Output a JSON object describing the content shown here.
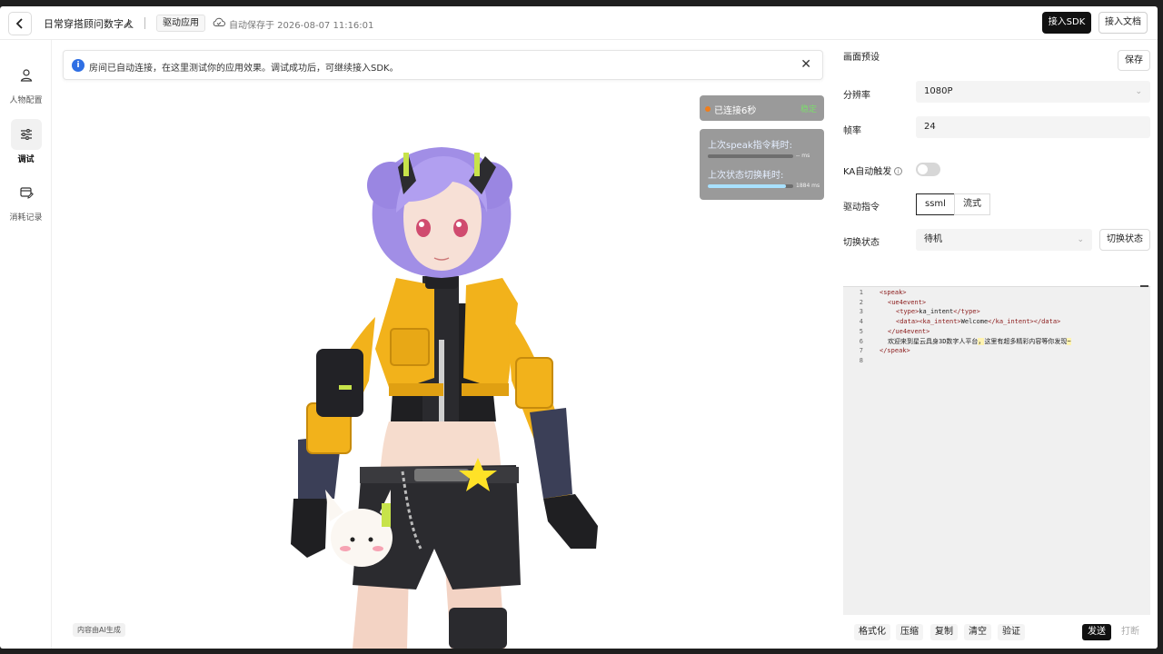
{
  "header": {
    "title": "日常穿搭顾问数字人",
    "tag": "驱动应用",
    "autosave": "自动保存于 2026-08-07 11:16:01",
    "sdk_button": "接入SDK",
    "doc_button": "接入文档"
  },
  "sidebar": {
    "items": [
      {
        "label": "人物配置",
        "icon": "person-icon"
      },
      {
        "label": "调试",
        "icon": "sliders-icon"
      },
      {
        "label": "消耗记录",
        "icon": "card-edit-icon"
      }
    ],
    "active": "调试"
  },
  "stage": {
    "notice": "房间已自动连接，在这里测试你的应用效果。调试成功后，可继续接入SDK。",
    "connection_text": "已连接6秒",
    "connection_status": "稳定",
    "metrics": [
      {
        "label": "上次speak指令耗时:",
        "value": "-- ms",
        "fill": 0
      },
      {
        "label": "上次状态切换耗时:",
        "value": "1884 ms",
        "fill": 0.92
      }
    ],
    "ai_tag": "内容由AI生成"
  },
  "panel": {
    "section_title": "画面预设",
    "save_button": "保存",
    "resolution_label": "分辨率",
    "resolution_value": "1080P",
    "framerate_label": "帧率",
    "framerate_value": "24",
    "ka_label": "KA自动触发",
    "ka_enabled": false,
    "drive_label": "驱动指令",
    "drive_options": [
      "ssml",
      "流式"
    ],
    "drive_selected": "ssml",
    "switch_label": "切换状态",
    "switch_value": "待机",
    "switch_button": "切换状态"
  },
  "editor": {
    "line_numbers": [
      "1",
      "2",
      "3",
      "4",
      "5",
      "6",
      "7",
      "8"
    ],
    "lines": {
      "l1": "<speak>",
      "l2": "<ue4event>",
      "l3a": "<type>",
      "l3b": "ka_intent",
      "l3c": "</type>",
      "l4a": "<data><ka_intent>",
      "l4b": "Welcome",
      "l4c": "</ka_intent></data>",
      "l5": "</ue4event>",
      "l6a": "欢迎来到星云具身3D数字人平台",
      "l6b": "，",
      "l6c": "这里有超多精彩内容等你发现",
      "l6d": "~",
      "l7": "</speak>"
    }
  },
  "toolbar": {
    "format": "格式化",
    "compress": "压缩",
    "copy": "复制",
    "clear": "清空",
    "validate": "验证",
    "send": "发送",
    "interrupt": "打断"
  },
  "colors": {
    "accent": "#111111",
    "info": "#2f6fe4",
    "connection_dot": "#f07d1a",
    "connection_ok": "#7cdc6c",
    "metric_fill": "#a8e1ff"
  }
}
